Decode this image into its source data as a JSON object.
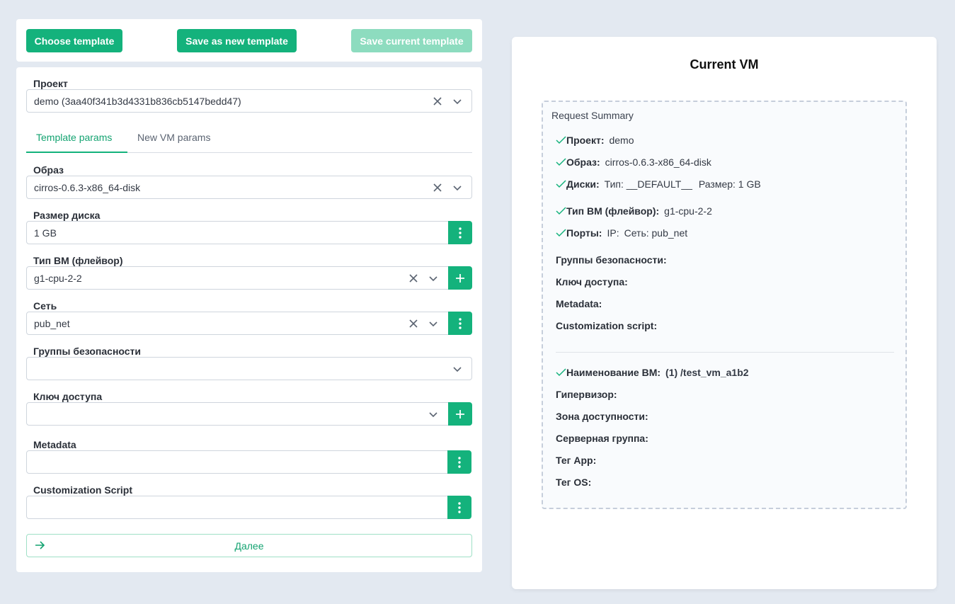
{
  "toolbar": {
    "choose_template": "Choose template",
    "save_as_new_template": "Save as new template",
    "save_current_template": "Save current template"
  },
  "project": {
    "label": "Проект",
    "value": "demo (3aa40f341b3d4331b836cb5147bedd47)"
  },
  "tabs": [
    {
      "label": "Template params",
      "active": true
    },
    {
      "label": "New VM params",
      "active": false
    }
  ],
  "fields": {
    "image": {
      "label": "Образ",
      "value": "cirros-0.6.3-x86_64-disk"
    },
    "disk_size": {
      "label": "Размер диска",
      "value": "1 GB"
    },
    "flavor": {
      "label": "Тип ВМ (флейвор)",
      "value": "g1-cpu-2-2"
    },
    "network": {
      "label": "Сеть",
      "value": "pub_net"
    },
    "security_groups": {
      "label": "Группы безопасности",
      "value": ""
    },
    "access_key": {
      "label": "Ключ доступа",
      "value": ""
    },
    "metadata": {
      "label": "Metadata",
      "value": ""
    },
    "custom_script": {
      "label": "Customization Script",
      "value": ""
    }
  },
  "next_label": "Далее",
  "summary": {
    "title": "Current VM",
    "heading": "Request Summary",
    "project": {
      "key": "Проект:",
      "value": "demo"
    },
    "image": {
      "key": "Образ:",
      "value": "cirros-0.6.3-x86_64-disk"
    },
    "disks": {
      "key": "Диски:",
      "type": "Тип: __DEFAULT__",
      "size": "Размер: 1 GB"
    },
    "flavor": {
      "key": "Тип ВМ (флейвор):",
      "value": "g1-cpu-2-2"
    },
    "ports": {
      "key": "Порты:",
      "ip": "IP:",
      "net": "Сеть: pub_net"
    },
    "security_groups": {
      "key": "Группы безопасности:"
    },
    "access_key": {
      "key": "Ключ доступа:"
    },
    "metadata": {
      "key": "Metadata:"
    },
    "custom_script": {
      "key": "Customization script:"
    },
    "vm_name": {
      "key": "Наименование ВМ:",
      "value": "(1) /test_vm_a1b2"
    },
    "hypervisor": {
      "key": "Гипервизор:"
    },
    "availability_zone": {
      "key": "Зона доступности:"
    },
    "server_group": {
      "key": "Серверная группа:"
    },
    "tag_app": {
      "key": "Тег App:"
    },
    "tag_os": {
      "key": "Тег OS:"
    }
  },
  "colors": {
    "accent": "#14b27c",
    "accent_disabled": "#8ddcbf",
    "background": "#e3e9f1"
  }
}
